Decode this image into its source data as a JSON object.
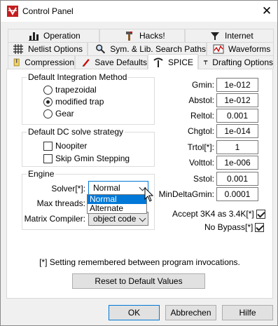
{
  "window": {
    "title": "Control Panel",
    "close_label": "✕"
  },
  "tabs": {
    "row1": [
      {
        "label": "Operation",
        "icon": "operation-icon"
      },
      {
        "label": "Hacks!",
        "icon": "hacks-icon"
      },
      {
        "label": "Internet",
        "icon": "internet-icon"
      }
    ],
    "row2": [
      {
        "label": "Netlist Options",
        "icon": "netlist-icon"
      },
      {
        "label": "Sym. & Lib. Search Paths",
        "icon": "search-paths-icon"
      },
      {
        "label": "Waveforms",
        "icon": "waveforms-icon"
      }
    ],
    "row3": [
      {
        "label": "Compression",
        "icon": "compression-icon"
      },
      {
        "label": "Save Defaults",
        "icon": "save-defaults-icon"
      },
      {
        "label": "SPICE",
        "icon": "spice-icon",
        "active": true
      },
      {
        "label": "Drafting Options",
        "icon": "drafting-icon"
      }
    ]
  },
  "integration": {
    "title": "Default Integration Method",
    "options": [
      {
        "label": "trapezoidal",
        "selected": false
      },
      {
        "label": "modified trap",
        "selected": true
      },
      {
        "label": "Gear",
        "selected": false
      }
    ]
  },
  "dc_strategy": {
    "title": "Default DC solve strategy",
    "options": [
      {
        "label": "Noopiter",
        "checked": false
      },
      {
        "label": "Skip Gmin Stepping",
        "checked": false
      }
    ]
  },
  "engine": {
    "title": "Engine",
    "solver_label": "Solver[*]:",
    "solver_value": "Normal",
    "solver_options": [
      "Normal",
      "Alternate"
    ],
    "threads_label": "Max threads:",
    "compiler_label": "Matrix Compiler:",
    "compiler_value": "object code"
  },
  "params": [
    {
      "label": "Gmin:",
      "value": "1e-012"
    },
    {
      "label": "Abstol:",
      "value": "1e-012"
    },
    {
      "label": "Reltol:",
      "value": "0.001"
    },
    {
      "label": "Chgtol:",
      "value": "1e-014"
    },
    {
      "label": "Trtol[*]:",
      "value": "1"
    },
    {
      "label": "Volttol:",
      "value": "1e-006"
    },
    {
      "label": "Sstol:",
      "value": "0.001"
    },
    {
      "label": "MinDeltaGmin:",
      "value": "0.0001"
    }
  ],
  "checks": [
    {
      "label": "Accept 3K4 as 3.4K[*]",
      "checked": true
    },
    {
      "label": "No Bypass[*]",
      "checked": true
    }
  ],
  "note": "[*] Setting remembered between program invocations.",
  "buttons": {
    "reset": "Reset to Default Values",
    "ok": "OK",
    "cancel": "Abbrechen",
    "help": "Hilfe"
  }
}
